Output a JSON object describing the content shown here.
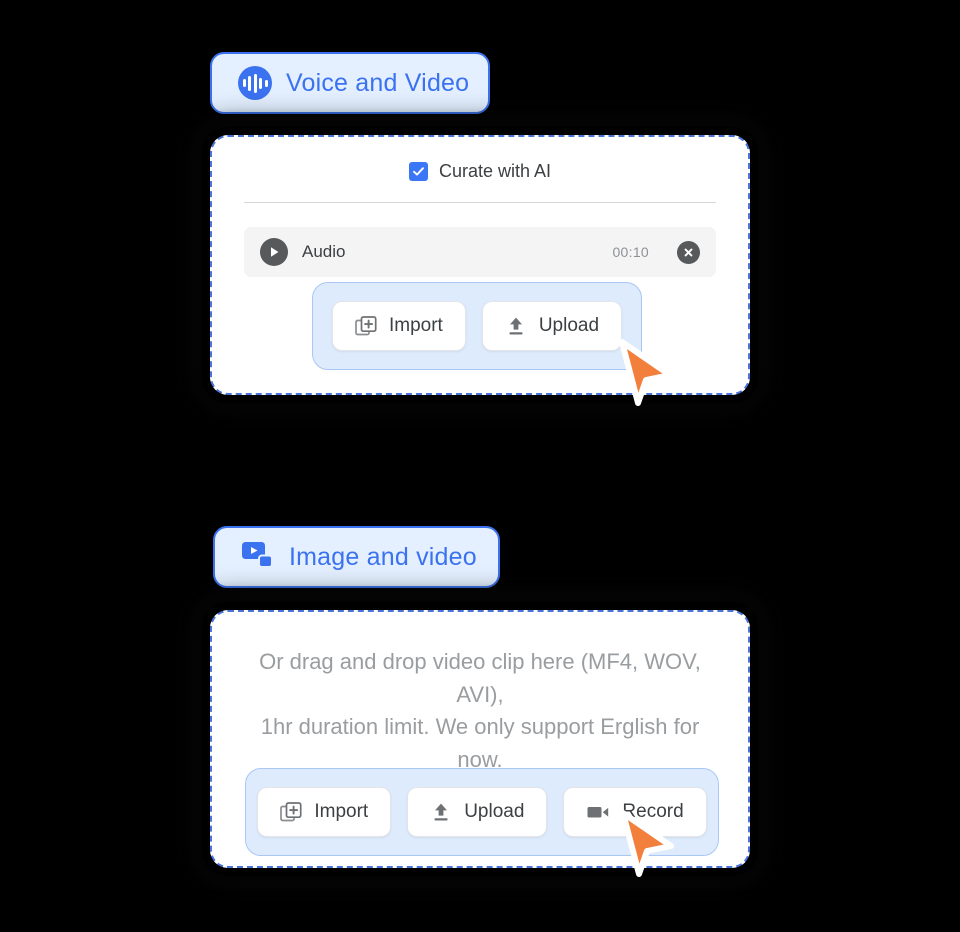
{
  "theme": {
    "background": "#000000",
    "accent_blue": "#3b72f0",
    "pill_fill": "#e4f0ff",
    "action_group_fill": "#ddebfd",
    "card_border": "#4a74d8",
    "cursor_color": "#f2803c",
    "muted_text": "#9a9da0"
  },
  "panel_voice": {
    "pill": {
      "label": "Voice and Video",
      "icon": "audio-waveform-icon"
    },
    "curate": {
      "label": "Curate with AI",
      "checked": true
    },
    "audio_item": {
      "play_icon": "play-icon",
      "name": "Audio",
      "duration": "00:10",
      "remove_icon": "close-circle-icon"
    },
    "actions": [
      {
        "label": "Import",
        "icon": "library-add-icon"
      },
      {
        "label": "Upload",
        "icon": "upload-arrow-icon"
      }
    ],
    "cursor": {
      "icon": "pointer-cursor-icon"
    }
  },
  "panel_image_video": {
    "pill": {
      "label": "Image and video",
      "icon": "video-play-icon"
    },
    "dropzone": {
      "line1": "Or drag and drop video clip here (MF4, WOV, AVI),",
      "line2": "1hr duration limit. We only support Erglish for now."
    },
    "actions": [
      {
        "label": "Import",
        "icon": "library-add-icon"
      },
      {
        "label": "Upload",
        "icon": "upload-arrow-icon"
      },
      {
        "label": "Record",
        "icon": "videocam-icon"
      }
    ],
    "cursor": {
      "icon": "pointer-cursor-icon"
    }
  }
}
